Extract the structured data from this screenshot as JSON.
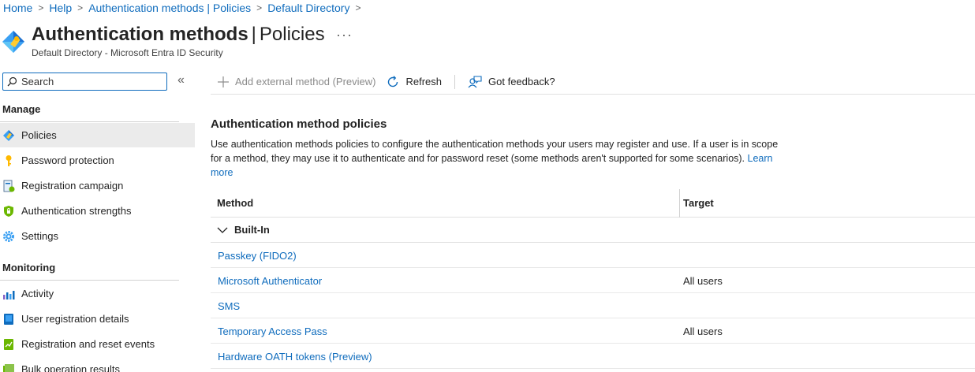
{
  "breadcrumb": {
    "items": [
      "Home",
      "Help",
      "Authentication methods | Policies",
      "Default Directory"
    ]
  },
  "header": {
    "title_main": "Authentication methods",
    "title_sep": "|",
    "title_section": "Policies",
    "more_label": "···",
    "subtitle": "Default Directory - Microsoft Entra ID Security"
  },
  "sidebar": {
    "search_placeholder": "Search",
    "collapse_label": "«",
    "manage_label": "Manage",
    "manage_items": [
      {
        "label": "Policies",
        "icon": "policy-icon",
        "selected": true
      },
      {
        "label": "Password protection",
        "icon": "key-icon"
      },
      {
        "label": "Registration campaign",
        "icon": "registration-icon"
      },
      {
        "label": "Authentication strengths",
        "icon": "shield-icon"
      },
      {
        "label": "Settings",
        "icon": "gear-icon"
      }
    ],
    "monitoring_label": "Monitoring",
    "monitoring_items": [
      {
        "label": "Activity",
        "icon": "chart-icon"
      },
      {
        "label": "User registration details",
        "icon": "user-details-icon"
      },
      {
        "label": "Registration and reset events",
        "icon": "events-icon"
      },
      {
        "label": "Bulk operation results",
        "icon": "bulk-icon"
      }
    ]
  },
  "toolbar": {
    "add_label": "Add external method (Preview)",
    "refresh_label": "Refresh",
    "feedback_label": "Got feedback?"
  },
  "content": {
    "title": "Authentication method policies",
    "description": "Use authentication methods policies to configure the authentication methods your users may register and use. If a user is in scope for a method, they may use it to authenticate and for password reset (some methods aren't supported for some scenarios).",
    "learn_more": "Learn more"
  },
  "table": {
    "col_method": "Method",
    "col_target": "Target",
    "group": "Built-In",
    "rows": [
      {
        "method": "Passkey (FIDO2)",
        "target": ""
      },
      {
        "method": "Microsoft Authenticator",
        "target": "All users"
      },
      {
        "method": "SMS",
        "target": ""
      },
      {
        "method": "Temporary Access Pass",
        "target": "All users"
      },
      {
        "method": "Hardware OATH tokens (Preview)",
        "target": ""
      }
    ]
  },
  "colors": {
    "accent": "#0f6cbd",
    "selected_bg": "#ebebeb"
  }
}
